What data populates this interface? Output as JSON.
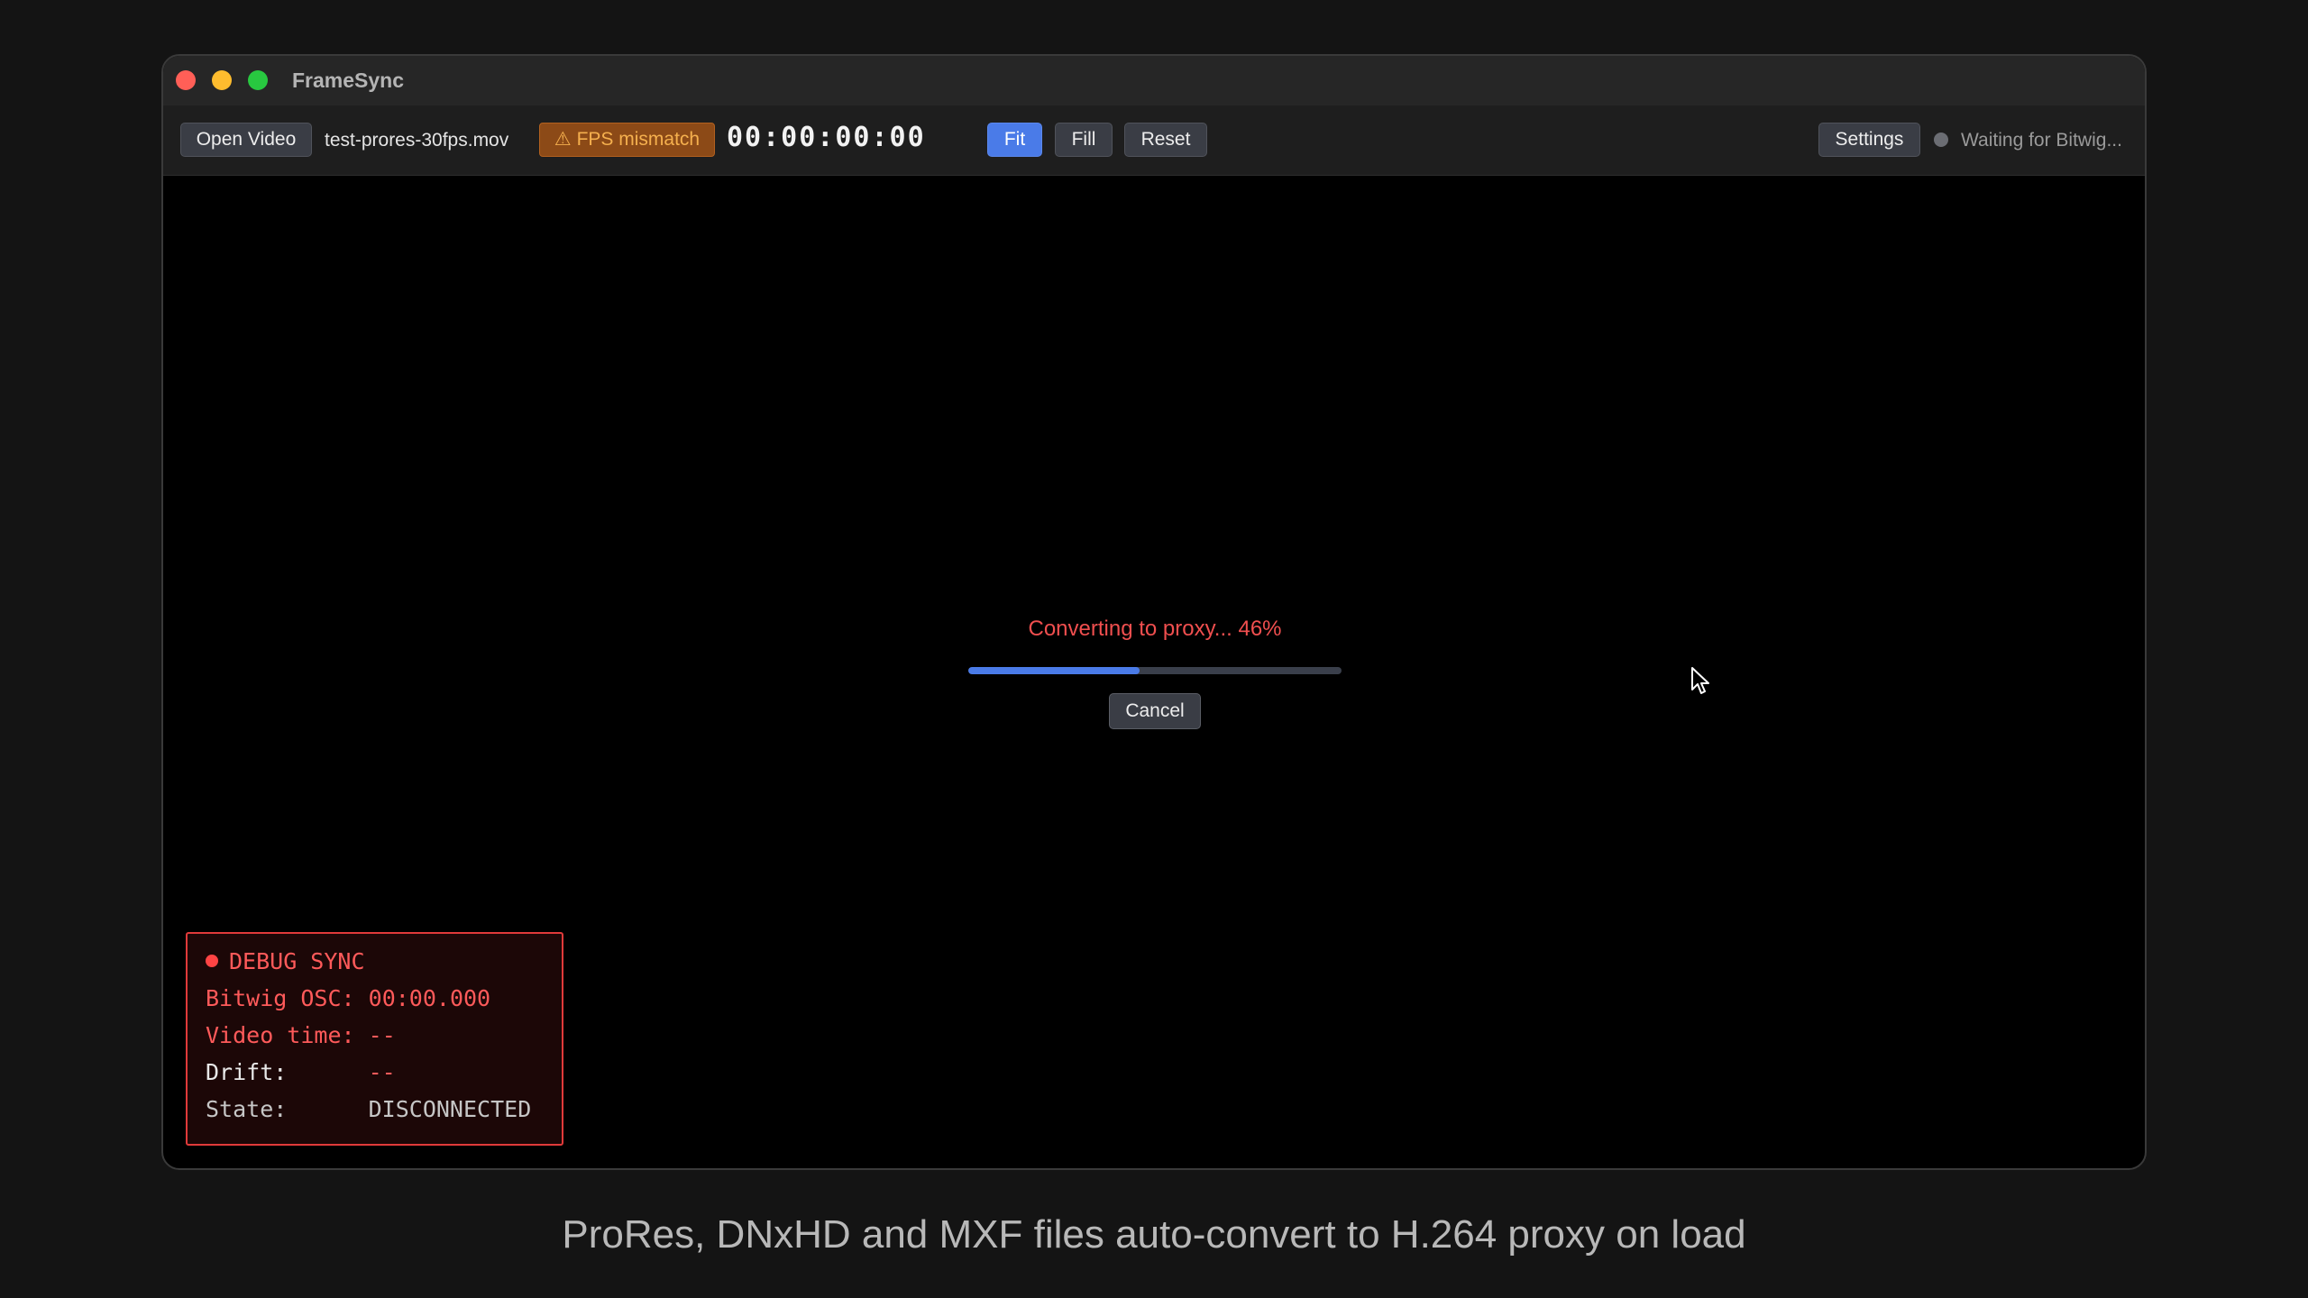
{
  "window": {
    "title": "FrameSync"
  },
  "toolbar": {
    "open_video_label": "Open Video",
    "filename": "test-prores-30fps.mov",
    "fps_warning_icon": "⚠",
    "fps_warning_label": "FPS mismatch",
    "timecode": "00:00:00:00",
    "fit_label": "Fit",
    "fill_label": "Fill",
    "reset_label": "Reset",
    "active_view_mode": "Fit",
    "settings_label": "Settings",
    "connection_status": "Waiting for Bitwig..."
  },
  "conversion": {
    "label": "Converting to proxy... 46%",
    "progress": 0.46,
    "cancel_label": "Cancel"
  },
  "debug_panel": {
    "title": "DEBUG SYNC",
    "rows": [
      {
        "label": "Bitwig OSC:",
        "value": "00:00.000"
      },
      {
        "label": "Video time:",
        "value": "--"
      },
      {
        "label": "Drift:",
        "value": "--"
      },
      {
        "label": "State:",
        "value": "DISCONNECTED"
      }
    ]
  },
  "caption": "ProRes, DNxHD and MXF files auto-convert to H.264 proxy on load",
  "colors": {
    "accent": "#4a7be8",
    "warning": "#f5b04e",
    "error": "#f04f4f"
  }
}
